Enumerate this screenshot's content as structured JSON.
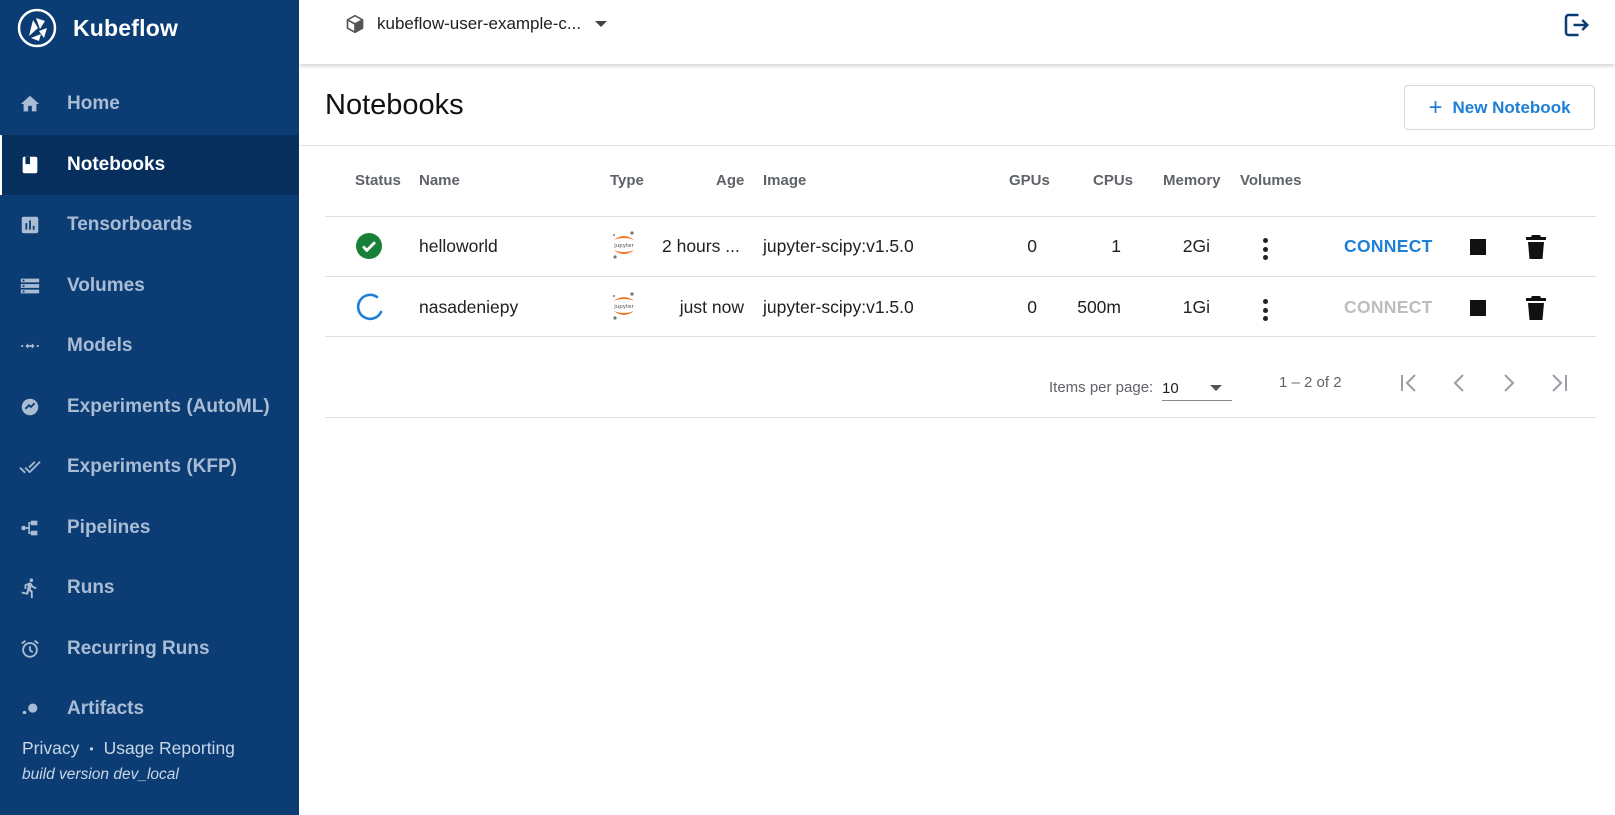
{
  "app": {
    "name": "Kubeflow"
  },
  "sidebar": {
    "items": [
      {
        "label": "Home",
        "icon": "home-icon"
      },
      {
        "label": "Notebooks",
        "icon": "notebook-icon",
        "active": true
      },
      {
        "label": "Tensorboards",
        "icon": "chart-icon"
      },
      {
        "label": "Volumes",
        "icon": "storage-icon"
      },
      {
        "label": "Models",
        "icon": "arrows-icon"
      },
      {
        "label": "Experiments (AutoML)",
        "icon": "automl-icon"
      },
      {
        "label": "Experiments (KFP)",
        "icon": "done-all-icon"
      },
      {
        "label": "Pipelines",
        "icon": "pipeline-icon"
      },
      {
        "label": "Runs",
        "icon": "run-icon"
      },
      {
        "label": "Recurring Runs",
        "icon": "alarm-icon"
      },
      {
        "label": "Artifacts",
        "icon": "bubble-icon"
      }
    ],
    "footer": {
      "privacy": "Privacy",
      "separator": "•",
      "usage": "Usage Reporting",
      "build": "build version dev_local"
    }
  },
  "topbar": {
    "namespace": "kubeflow-user-example-c...",
    "logout_icon": "logout-icon"
  },
  "page": {
    "title": "Notebooks",
    "new_button": "New Notebook"
  },
  "table": {
    "headers": {
      "status": "Status",
      "name": "Name",
      "type": "Type",
      "age": "Age",
      "image": "Image",
      "gpus": "GPUs",
      "cpus": "CPUs",
      "memory": "Memory",
      "volumes": "Volumes"
    },
    "rows": [
      {
        "status": "ready",
        "name": "helloworld",
        "type": "jupyter",
        "age": "2 hours ...",
        "image": "jupyter-scipy:v1.5.0",
        "gpus": "0",
        "cpus": "1",
        "memory": "2Gi",
        "connect": "CONNECT",
        "connect_enabled": true
      },
      {
        "status": "waiting",
        "name": "nasadeniepy",
        "type": "jupyter",
        "age": "just now",
        "image": "jupyter-scipy:v1.5.0",
        "gpus": "0",
        "cpus": "500m",
        "memory": "1Gi",
        "connect": "CONNECT",
        "connect_enabled": false
      }
    ]
  },
  "paginator": {
    "items_per_page_label": "Items per page:",
    "page_size": "10",
    "range": "1 – 2 of 2"
  },
  "colors": {
    "sidebar_bg": "#0b3d74",
    "accent": "#1e7fd6",
    "status_ok": "#188038",
    "disabled": "#bdbdbd"
  }
}
